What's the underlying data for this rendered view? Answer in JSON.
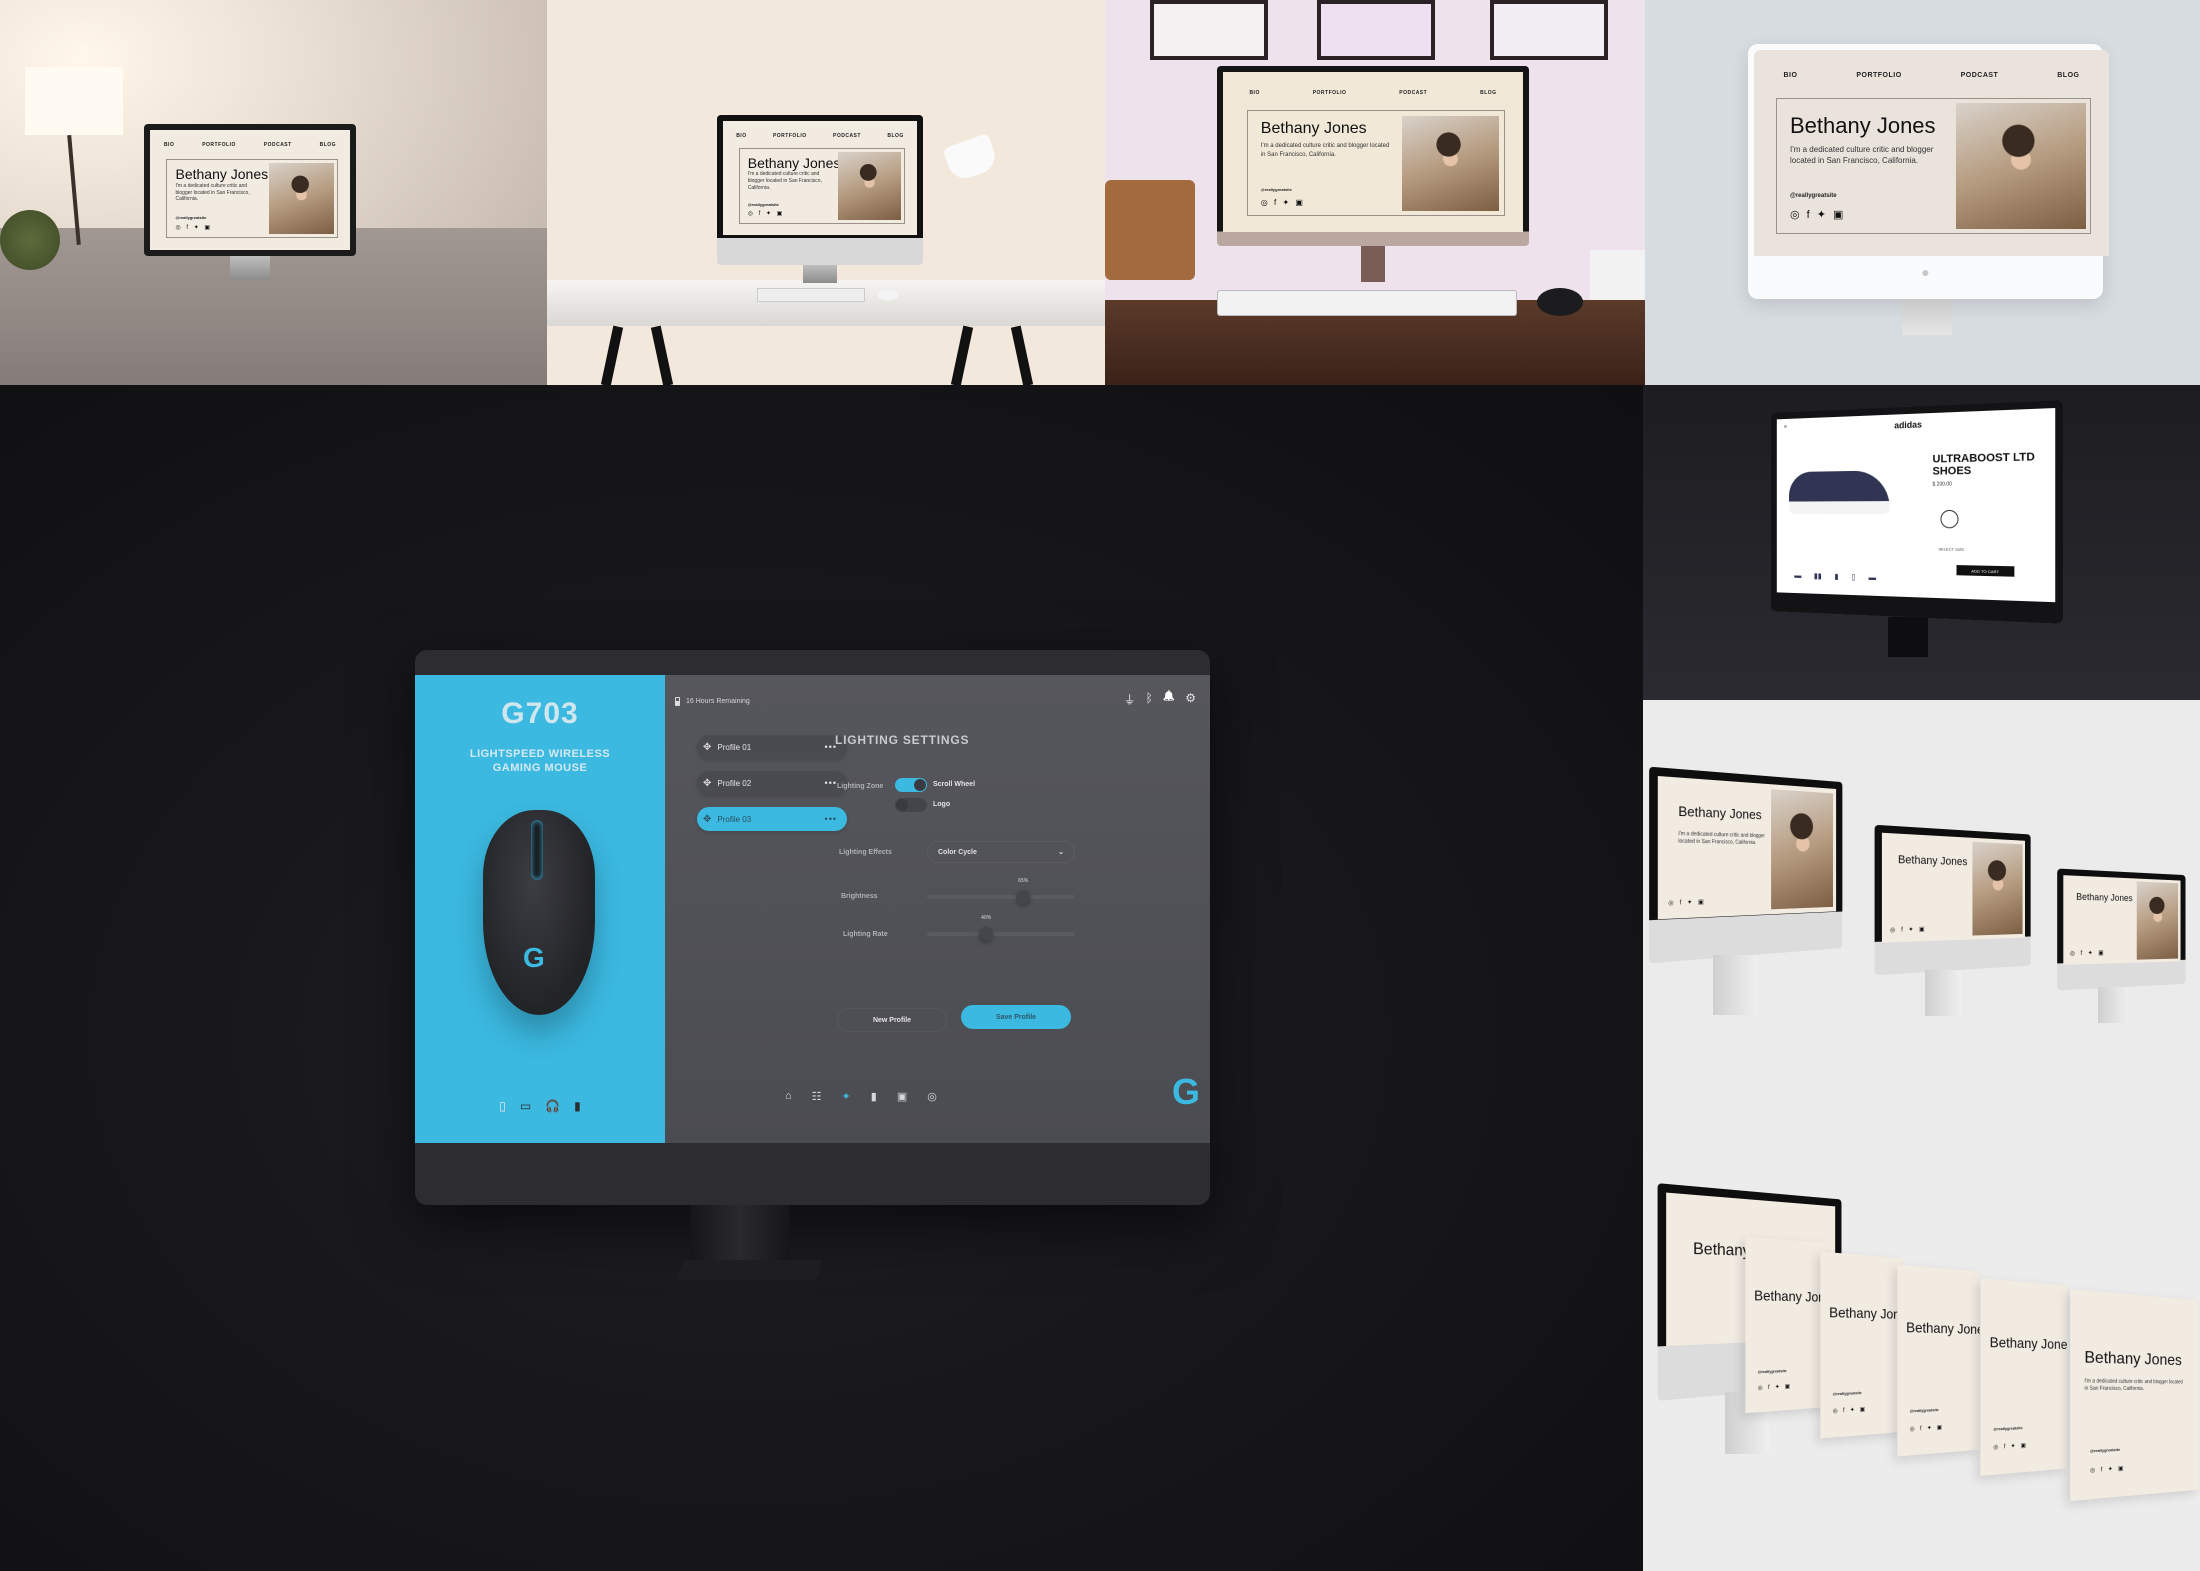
{
  "site": {
    "nav": [
      "BIO",
      "PORTFOLIO",
      "PODCAST",
      "BLOG"
    ],
    "name": "Bethany Jones",
    "bio": "I'm a dedicated culture critic and blogger located in San Francisco, California.",
    "handle": "@reallygreatsite",
    "social_icons": [
      "instagram-icon",
      "facebook-icon",
      "twitter-icon",
      "linkedin-icon"
    ],
    "social_glyphs": "◎ f ✦ ▣"
  },
  "g703": {
    "model": "G703",
    "subtitle": "LIGHTSPEED WIRELESS GAMING MOUSE",
    "battery_text": "16 Hours Remaining",
    "top_icons": [
      "usb-icon",
      "bluetooth-icon",
      "bell-icon",
      "gear-icon"
    ],
    "top_glyphs": {
      "usb": "⏚",
      "bluetooth": "ᛒ",
      "bell": "🔔",
      "gear": "⚙"
    },
    "profiles": [
      {
        "label": "Profile 01",
        "active": false
      },
      {
        "label": "Profile 02",
        "active": false
      },
      {
        "label": "Profile 03",
        "active": true
      }
    ],
    "more_glyph": "•••",
    "dpad_glyph": "✥",
    "settings_title": "LIGHTING SETTINGS",
    "lighting_zone_label": "Lighting Zone",
    "zones": [
      {
        "label": "Scroll Wheel",
        "on": true
      },
      {
        "label": "Logo",
        "on": false
      }
    ],
    "lighting_effects_label": "Lighting Effects",
    "lighting_effects_value": "Color Cycle",
    "brightness_label": "Brightness",
    "brightness_value": "65%",
    "brightness_fraction": 0.65,
    "lighting_rate_label": "Lighting Rate",
    "lighting_rate_value": "40%",
    "lighting_rate_fraction": 0.4,
    "new_profile_label": "New Profile",
    "save_profile_label": "Save Profile",
    "device_icons": [
      "mouse-icon",
      "keyboard-icon",
      "headset-icon",
      "speaker-icon"
    ],
    "device_glyphs": [
      "▯",
      "▭",
      "🎧",
      "▮"
    ],
    "nav_icons": [
      "home-icon",
      "sliders-icon",
      "lighting-icon",
      "battery-icon",
      "window-icon",
      "dpi-icon"
    ],
    "nav_glyphs": [
      "⌂",
      "☷",
      "✦",
      "▮",
      "▣",
      "◎"
    ],
    "active_nav_index": 2,
    "mouse_logo": "G",
    "brand_logo": "G",
    "accent_color": "#3bb9e1"
  },
  "adidas": {
    "logo": "adidas",
    "product_title": "ULTRABOOST LTD SHOES",
    "price": "$ 200.00",
    "select_size": "SELECT SIZE",
    "add_to_cart": "ADD TO CART"
  }
}
